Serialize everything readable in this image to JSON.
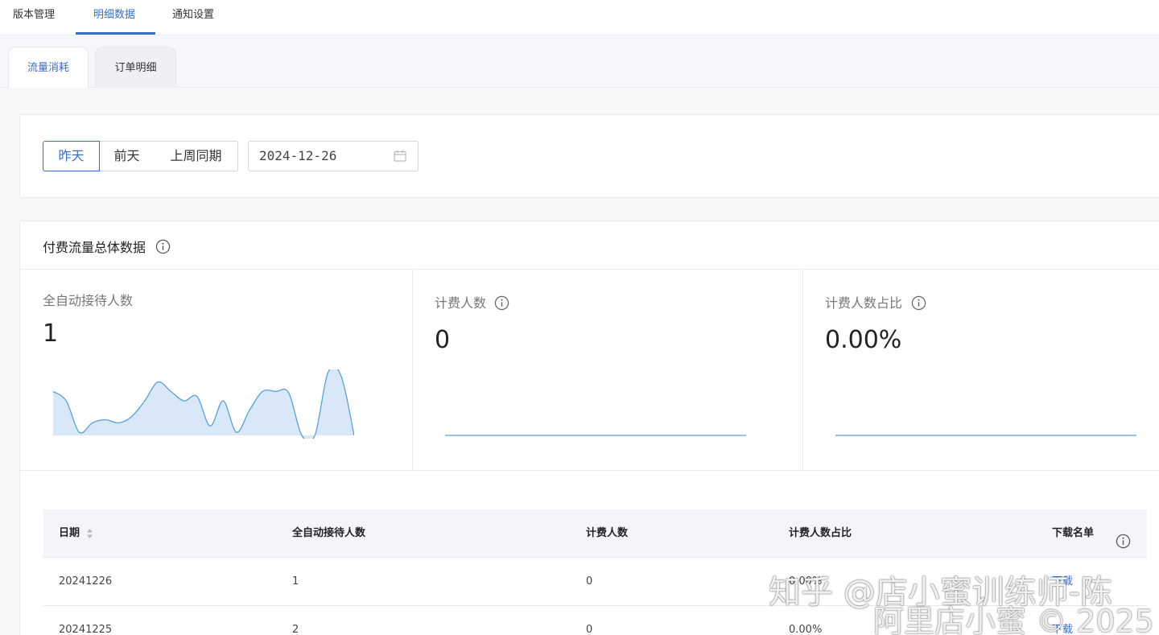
{
  "top_tabs": [
    {
      "label": "版本管理",
      "active": false
    },
    {
      "label": "明细数据",
      "active": true
    },
    {
      "label": "通知设置",
      "active": false
    }
  ],
  "sub_tabs": [
    {
      "label": "流量消耗",
      "active": true
    },
    {
      "label": "订单明细",
      "active": false
    }
  ],
  "filter": {
    "segments": [
      {
        "label": "昨天",
        "active": true
      },
      {
        "label": "前天",
        "active": false
      },
      {
        "label": "上周同期",
        "active": false
      }
    ],
    "date_value": "2024-12-26",
    "icon": "calendar-icon"
  },
  "stats": {
    "title": "付费流量总体数据",
    "metrics": [
      {
        "label": "全自动接待人数",
        "value": "1",
        "has_info": false
      },
      {
        "label": "计费人数",
        "value": "0",
        "has_info": true
      },
      {
        "label": "计费人数占比",
        "value": "0.00%",
        "has_info": true
      }
    ]
  },
  "chart_data": [
    {
      "type": "area",
      "metric": "全自动接待人数",
      "values": [
        0.7,
        0.55,
        0.05,
        0.2,
        0.25,
        0.2,
        0.3,
        0.55,
        0.85,
        0.7,
        0.55,
        0.62,
        0.15,
        0.55,
        0.05,
        0.4,
        0.7,
        0.7,
        0.68,
        0.0,
        0.0,
        1.0,
        0.95,
        0.0
      ],
      "fill": "#d8e8f8",
      "stroke": "#5b9fd6"
    },
    {
      "type": "line",
      "metric": "计费人数",
      "values": [
        0,
        0,
        0,
        0,
        0,
        0,
        0,
        0,
        0,
        0,
        0,
        0
      ],
      "stroke": "#5b9fd6"
    },
    {
      "type": "line",
      "metric": "计费人数占比",
      "values": [
        0,
        0,
        0,
        0,
        0,
        0,
        0,
        0,
        0,
        0,
        0,
        0
      ],
      "stroke": "#5b9fd6"
    }
  ],
  "table": {
    "headers": [
      "日期",
      "全自动接待人数",
      "计费人数",
      "计费人数占比",
      "下载名单"
    ],
    "rows": [
      {
        "date": "20241226",
        "auto": "1",
        "billed": "0",
        "ratio": "0.00%",
        "download": "下载"
      },
      {
        "date": "20241225",
        "auto": "2",
        "billed": "0",
        "ratio": "0.00%",
        "download": "下载"
      }
    ]
  },
  "watermark": {
    "line1": "知乎 @店小蜜训练师-陈",
    "line2": "阿里店小蜜 © 2025"
  },
  "colors": {
    "accent": "#3a6fc2",
    "chart_stroke": "#5b9fd6",
    "chart_fill": "#d8e8f8"
  }
}
